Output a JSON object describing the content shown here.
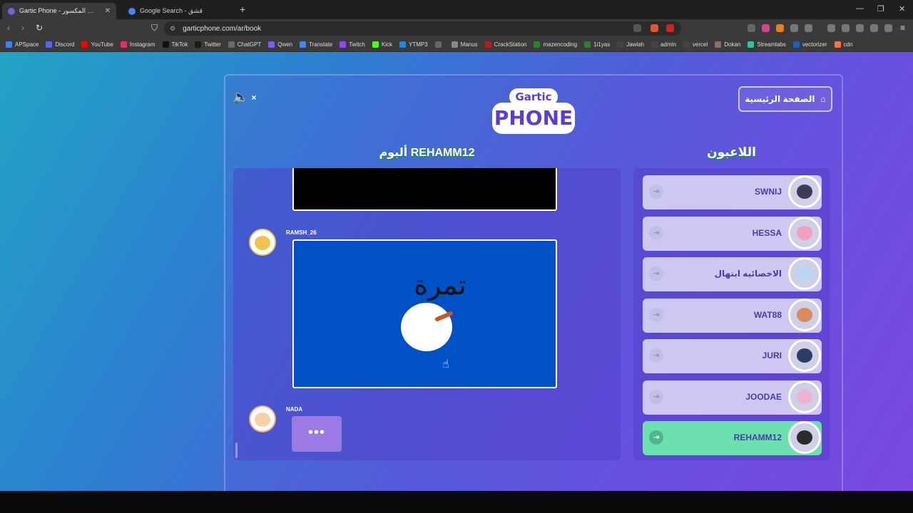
{
  "browser": {
    "tabs": [
      {
        "title": "Gartic Phone - لعبة الهاتف المكسور",
        "active": true,
        "favicon_color": "#7b5cd6"
      },
      {
        "title": "Google Search - قشق",
        "active": false,
        "favicon_color": "#4285f4"
      }
    ],
    "url": "garticphone.com/ar/book",
    "bookmarks": [
      {
        "label": "APSpace",
        "color": "#3b82f6"
      },
      {
        "label": "Discord",
        "color": "#5865f2"
      },
      {
        "label": "YouTube",
        "color": "#ff0000"
      },
      {
        "label": "Instagram",
        "color": "#e1306c"
      },
      {
        "label": "TikTok",
        "color": "#111111"
      },
      {
        "label": "Twitter",
        "color": "#1a1a1a"
      },
      {
        "label": "ChatGPT",
        "color": "#6b6b6b"
      },
      {
        "label": "Qwen",
        "color": "#7c5cff"
      },
      {
        "label": "Translate",
        "color": "#4285f4"
      },
      {
        "label": "Twitch",
        "color": "#9146ff"
      },
      {
        "label": "Kick",
        "color": "#53fc18"
      },
      {
        "label": "YTMP3",
        "color": "#1e88e5"
      },
      {
        "label": "",
        "color": "#666666"
      },
      {
        "label": "Manus",
        "color": "#888888"
      },
      {
        "label": "CrackStation",
        "color": "#b71c1c"
      },
      {
        "label": "mazencoding",
        "color": "#2e7d32"
      },
      {
        "label": "1i1yas",
        "color": "#2e7d32"
      },
      {
        "label": "Jawlah",
        "color": "#444444"
      },
      {
        "label": "admin",
        "color": "#444444"
      },
      {
        "label": "vercel",
        "color": "#444444"
      },
      {
        "label": "Dokan",
        "color": "#8d6e63"
      },
      {
        "label": "Streamlabs",
        "color": "#31c3a2"
      },
      {
        "label": "vectorizer",
        "color": "#1565c0"
      },
      {
        "label": "cdn",
        "color": "#ff7043"
      }
    ]
  },
  "game": {
    "logo_top": "Gartic",
    "logo_main": "PHONE",
    "home_button": "الصفحة الرئيسية",
    "album_title": "ألبوم REHAMM12",
    "players_title": "اللاعبون",
    "entries": [
      {
        "name": "RAMSH_26"
      },
      {
        "name": "NADA"
      }
    ],
    "drawing_text": "تمرة",
    "typing_indicator": "•••",
    "players": [
      {
        "name": "SWNIJ",
        "face_color": "#3b3b55",
        "active": false
      },
      {
        "name": "HESSA",
        "face_color": "#f2a0c0",
        "active": false
      },
      {
        "name": "الاخصائيه ابتهال",
        "face_color": "#b9d7f0",
        "active": false
      },
      {
        "name": "WAT88",
        "face_color": "#d98b5f",
        "active": false
      },
      {
        "name": "JURI",
        "face_color": "#2c3e66",
        "active": false
      },
      {
        "name": "JOODAE",
        "face_color": "#f0b3d6",
        "active": false
      },
      {
        "name": "REHAMM12",
        "face_color": "#2b2b2b",
        "active": true
      }
    ]
  }
}
